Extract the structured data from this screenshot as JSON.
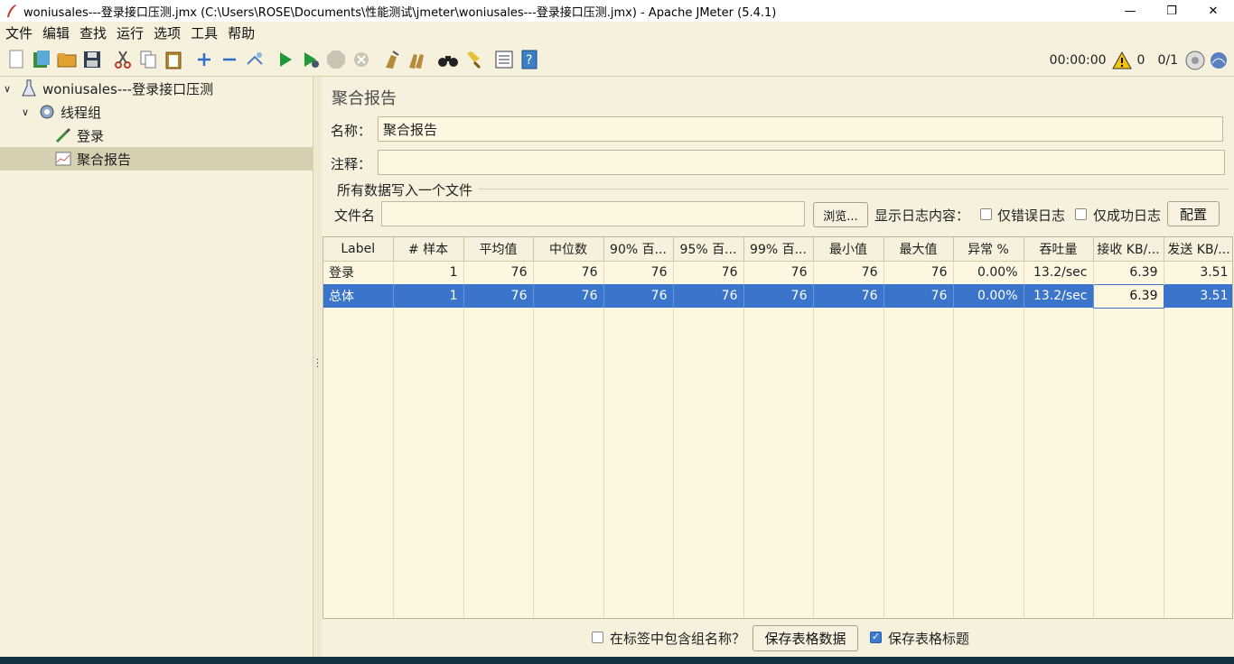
{
  "window": {
    "title": "woniusales---登录接口压测.jmx (C:\\Users\\ROSE\\Documents\\性能测试\\jmeter\\woniusales---登录接口压测.jmx) - Apache JMeter (5.4.1)",
    "minimize": "—",
    "restore": "❐",
    "close": "✕"
  },
  "menu": [
    "文件",
    "编辑",
    "查找",
    "运行",
    "选项",
    "工具",
    "帮助"
  ],
  "toolbar": {
    "timer": "00:00:00",
    "warnings": "0",
    "threads": "0/1"
  },
  "tree": {
    "root": "woniusales---登录接口压测",
    "thread_group": "线程组",
    "sampler": "登录",
    "listener": "聚合报告"
  },
  "panel": {
    "title": "聚合报告",
    "name_label": "名称：",
    "name_value": "聚合报告",
    "comment_label": "注释：",
    "comment_value": "",
    "file_section": "所有数据写入一个文件",
    "file_label": "文件名",
    "file_value": "",
    "browse_button": "浏览...",
    "log_label": "显示日志内容：",
    "errors_only": "仅错误日志",
    "success_only": "仅成功日志",
    "config_button": "配置"
  },
  "table": {
    "headers": [
      "Label",
      "# 样本",
      "平均值",
      "中位数",
      "90% 百...",
      "95% 百...",
      "99% 百...",
      "最小值",
      "最大值",
      "异常 %",
      "吞吐量",
      "接收 KB/...",
      "发送 KB/..."
    ],
    "rows": [
      [
        "登录",
        "1",
        "76",
        "76",
        "76",
        "76",
        "76",
        "76",
        "76",
        "0.00%",
        "13.2/sec",
        "6.39",
        "3.51"
      ],
      [
        "总体",
        "1",
        "76",
        "76",
        "76",
        "76",
        "76",
        "76",
        "76",
        "0.00%",
        "13.2/sec",
        "6.39",
        "3.51"
      ]
    ]
  },
  "footer": {
    "include_group": "在标签中包含组名称？",
    "save_data": "保存表格数据",
    "save_header": "保存表格标题"
  }
}
